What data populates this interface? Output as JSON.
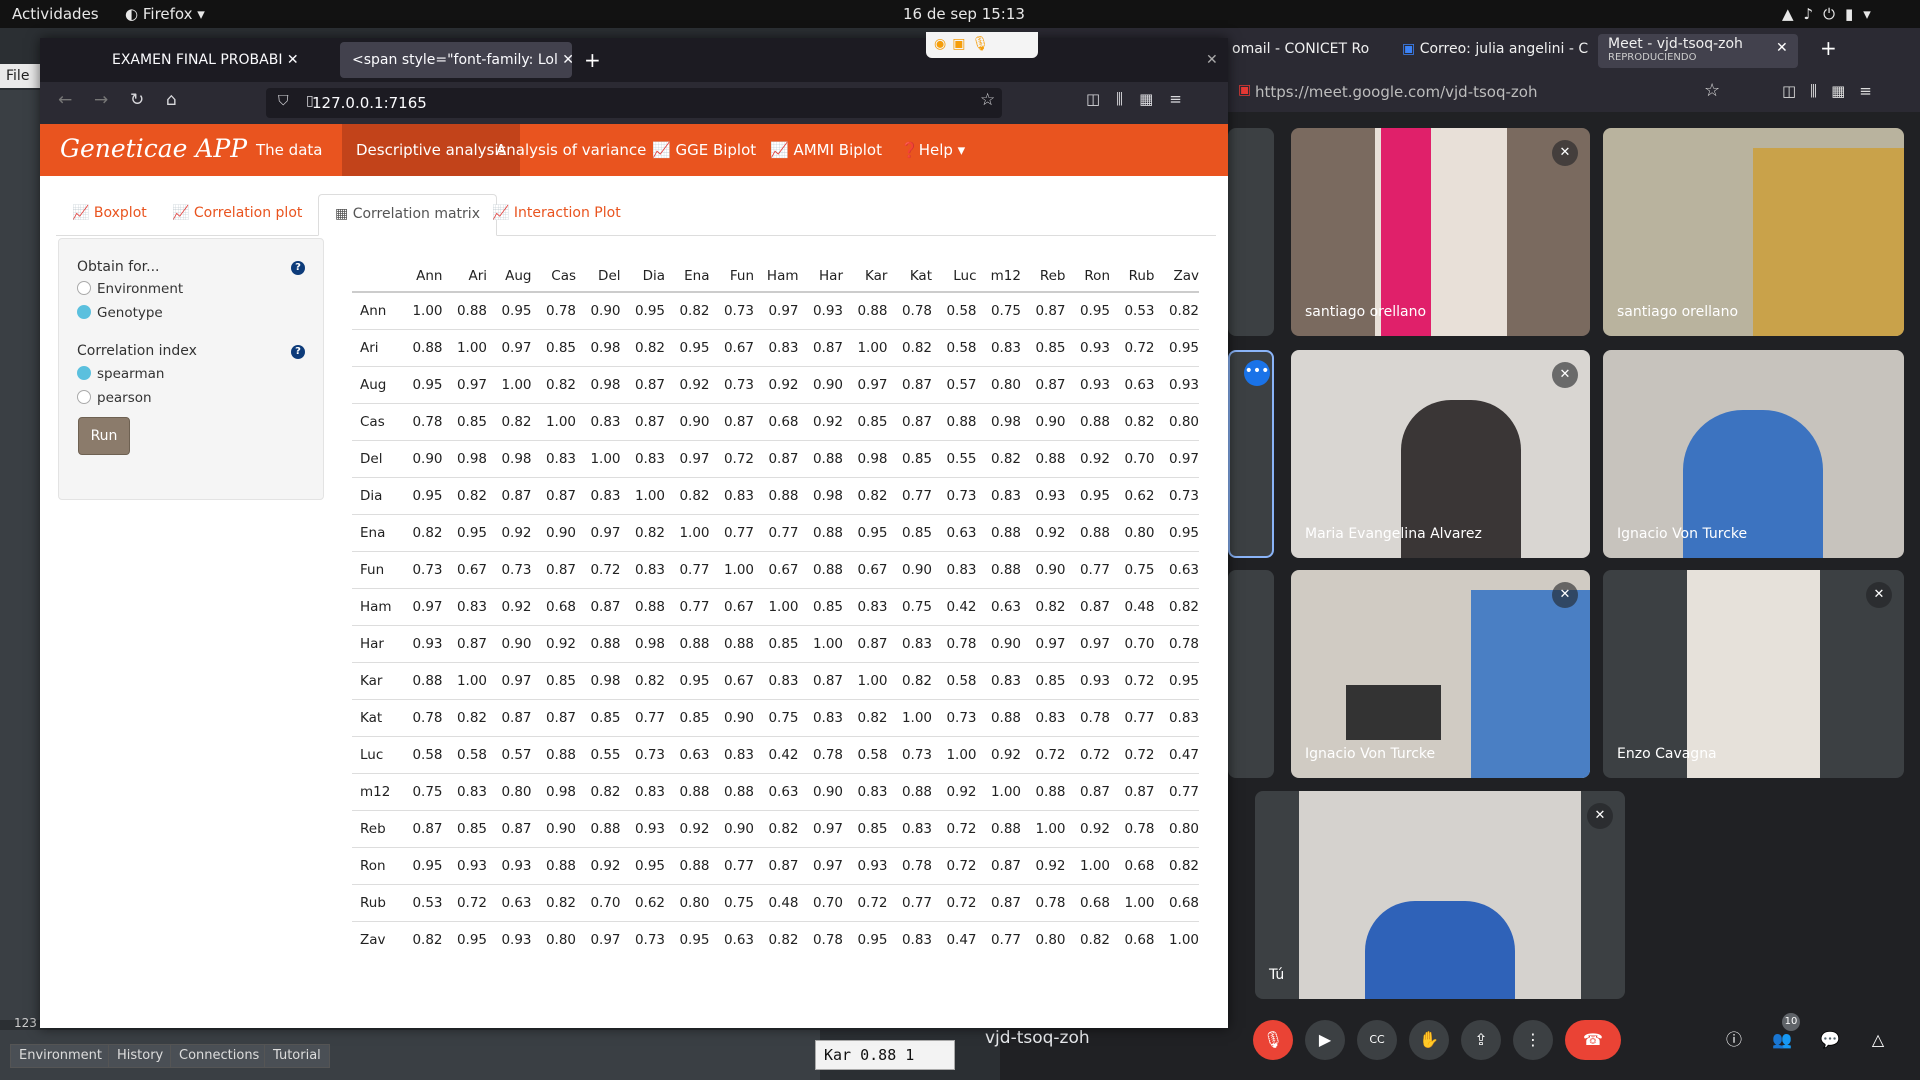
{
  "system": {
    "activities": "Actividades",
    "app": "Firefox",
    "datetime": "16 de sep  15:13"
  },
  "rstudio": {
    "menu_file": "File",
    "bottom_tabs": [
      "Environment",
      "History",
      "Connections",
      "Tutorial"
    ],
    "line_number": "123",
    "side_cell": "Kar   0.88  1"
  },
  "firefox": {
    "tabs": [
      "EXAMEN FINAL PROBABI",
      "<span style=\"font-family: Lol"
    ],
    "url": "127.0.0.1:7165"
  },
  "app": {
    "brand": "Geneticae APP",
    "nav": [
      "The data",
      "Descriptive analysis",
      "Analysis of variance",
      "GGE Biplot",
      "AMMI Biplot",
      "Help"
    ],
    "subtabs": [
      "Boxplot",
      "Correlation plot",
      "Correlation matrix",
      "Interaction Plot"
    ],
    "obtain_for_label": "Obtain for...",
    "obtain_options": [
      "Environment",
      "Genotype"
    ],
    "obtain_selected": "Genotype",
    "index_label": "Correlation index",
    "index_options": [
      "spearman",
      "pearson"
    ],
    "index_selected": "spearman",
    "run_label": "Run"
  },
  "matrix": {
    "labels": [
      "Ann",
      "Ari",
      "Aug",
      "Cas",
      "Del",
      "Dia",
      "Ena",
      "Fun",
      "Ham",
      "Har",
      "Kar",
      "Kat",
      "Luc",
      "m12",
      "Reb",
      "Ron",
      "Rub",
      "Zav"
    ],
    "rows": [
      [
        "1.00",
        "0.88",
        "0.95",
        "0.78",
        "0.90",
        "0.95",
        "0.82",
        "0.73",
        "0.97",
        "0.93",
        "0.88",
        "0.78",
        "0.58",
        "0.75",
        "0.87",
        "0.95",
        "0.53",
        "0.82"
      ],
      [
        "0.88",
        "1.00",
        "0.97",
        "0.85",
        "0.98",
        "0.82",
        "0.95",
        "0.67",
        "0.83",
        "0.87",
        "1.00",
        "0.82",
        "0.58",
        "0.83",
        "0.85",
        "0.93",
        "0.72",
        "0.95"
      ],
      [
        "0.95",
        "0.97",
        "1.00",
        "0.82",
        "0.98",
        "0.87",
        "0.92",
        "0.73",
        "0.92",
        "0.90",
        "0.97",
        "0.87",
        "0.57",
        "0.80",
        "0.87",
        "0.93",
        "0.63",
        "0.93"
      ],
      [
        "0.78",
        "0.85",
        "0.82",
        "1.00",
        "0.83",
        "0.87",
        "0.90",
        "0.87",
        "0.68",
        "0.92",
        "0.85",
        "0.87",
        "0.88",
        "0.98",
        "0.90",
        "0.88",
        "0.82",
        "0.80"
      ],
      [
        "0.90",
        "0.98",
        "0.98",
        "0.83",
        "1.00",
        "0.83",
        "0.97",
        "0.72",
        "0.87",
        "0.88",
        "0.98",
        "0.85",
        "0.55",
        "0.82",
        "0.88",
        "0.92",
        "0.70",
        "0.97"
      ],
      [
        "0.95",
        "0.82",
        "0.87",
        "0.87",
        "0.83",
        "1.00",
        "0.82",
        "0.83",
        "0.88",
        "0.98",
        "0.82",
        "0.77",
        "0.73",
        "0.83",
        "0.93",
        "0.95",
        "0.62",
        "0.73"
      ],
      [
        "0.82",
        "0.95",
        "0.92",
        "0.90",
        "0.97",
        "0.82",
        "1.00",
        "0.77",
        "0.77",
        "0.88",
        "0.95",
        "0.85",
        "0.63",
        "0.88",
        "0.92",
        "0.88",
        "0.80",
        "0.95"
      ],
      [
        "0.73",
        "0.67",
        "0.73",
        "0.87",
        "0.72",
        "0.83",
        "0.77",
        "1.00",
        "0.67",
        "0.88",
        "0.67",
        "0.90",
        "0.83",
        "0.88",
        "0.90",
        "0.77",
        "0.75",
        "0.63"
      ],
      [
        "0.97",
        "0.83",
        "0.92",
        "0.68",
        "0.87",
        "0.88",
        "0.77",
        "0.67",
        "1.00",
        "0.85",
        "0.83",
        "0.75",
        "0.42",
        "0.63",
        "0.82",
        "0.87",
        "0.48",
        "0.82"
      ],
      [
        "0.93",
        "0.87",
        "0.90",
        "0.92",
        "0.88",
        "0.98",
        "0.88",
        "0.88",
        "0.85",
        "1.00",
        "0.87",
        "0.83",
        "0.78",
        "0.90",
        "0.97",
        "0.97",
        "0.70",
        "0.78"
      ],
      [
        "0.88",
        "1.00",
        "0.97",
        "0.85",
        "0.98",
        "0.82",
        "0.95",
        "0.67",
        "0.83",
        "0.87",
        "1.00",
        "0.82",
        "0.58",
        "0.83",
        "0.85",
        "0.93",
        "0.72",
        "0.95"
      ],
      [
        "0.78",
        "0.82",
        "0.87",
        "0.87",
        "0.85",
        "0.77",
        "0.85",
        "0.90",
        "0.75",
        "0.83",
        "0.82",
        "1.00",
        "0.73",
        "0.88",
        "0.83",
        "0.78",
        "0.77",
        "0.83"
      ],
      [
        "0.58",
        "0.58",
        "0.57",
        "0.88",
        "0.55",
        "0.73",
        "0.63",
        "0.83",
        "0.42",
        "0.78",
        "0.58",
        "0.73",
        "1.00",
        "0.92",
        "0.72",
        "0.72",
        "0.72",
        "0.47"
      ],
      [
        "0.75",
        "0.83",
        "0.80",
        "0.98",
        "0.82",
        "0.83",
        "0.88",
        "0.88",
        "0.63",
        "0.90",
        "0.83",
        "0.88",
        "0.92",
        "1.00",
        "0.88",
        "0.87",
        "0.87",
        "0.77"
      ],
      [
        "0.87",
        "0.85",
        "0.87",
        "0.90",
        "0.88",
        "0.93",
        "0.92",
        "0.90",
        "0.82",
        "0.97",
        "0.85",
        "0.83",
        "0.72",
        "0.88",
        "1.00",
        "0.92",
        "0.78",
        "0.80"
      ],
      [
        "0.95",
        "0.93",
        "0.93",
        "0.88",
        "0.92",
        "0.95",
        "0.88",
        "0.77",
        "0.87",
        "0.97",
        "0.93",
        "0.78",
        "0.72",
        "0.87",
        "0.92",
        "1.00",
        "0.68",
        "0.82"
      ],
      [
        "0.53",
        "0.72",
        "0.63",
        "0.82",
        "0.70",
        "0.62",
        "0.80",
        "0.75",
        "0.48",
        "0.70",
        "0.72",
        "0.77",
        "0.72",
        "0.87",
        "0.78",
        "0.68",
        "1.00",
        "0.68"
      ],
      [
        "0.82",
        "0.95",
        "0.93",
        "0.80",
        "0.97",
        "0.73",
        "0.95",
        "0.63",
        "0.82",
        "0.78",
        "0.95",
        "0.83",
        "0.47",
        "0.77",
        "0.80",
        "0.82",
        "0.68",
        "1.00"
      ]
    ]
  },
  "meet": {
    "tabs": [
      "omail - CONICET Ro",
      "Correo: julia angelini - C",
      "Meet - vjd-tsoq-zoh"
    ],
    "playing": "REPRODUCIENDO",
    "url": "https://meet.google.com/vjd-tsoq-zoh",
    "participants": [
      "santiago orellano",
      "santiago orellano",
      "Maria Evangelina Alvarez",
      "Ignacio Von Turcke",
      "Ignacio Von Turcke",
      "Enzo Cavagna",
      "Tú"
    ],
    "meeting_code": "vjd-tsoq-zoh",
    "people_count": "10"
  }
}
